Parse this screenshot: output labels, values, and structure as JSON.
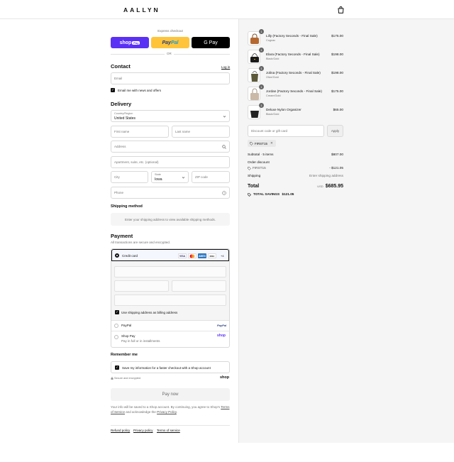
{
  "brand": {
    "name": "AALLYN"
  },
  "express": {
    "title": "Express checkout",
    "shop_label": "shop",
    "shop_badge": "Pay",
    "paypal_label_a": "Pay",
    "paypal_label_b": "Pal",
    "gpay_label": "G Pay",
    "or": "OR"
  },
  "contact": {
    "title": "Contact",
    "login": "Log in",
    "email_placeholder": "Email",
    "news_label": "Email me with news and offers"
  },
  "delivery": {
    "title": "Delivery",
    "country_label": "Country/Region",
    "country_value": "United States",
    "first_name": "First name",
    "last_name": "Last name",
    "address": "Address",
    "apartment": "Apartment, suite, etc. (optional)",
    "city": "City",
    "state_label": "State",
    "state_value": "Iowa",
    "zip": "ZIP code",
    "phone": "Phone"
  },
  "shipping": {
    "title": "Shipping method",
    "info": "Enter your shipping address to view available shipping methods."
  },
  "payment": {
    "title": "Payment",
    "subtitle": "All transactions are secure and encrypted.",
    "credit_card": "Credit card",
    "cards": [
      "VISA",
      "MC",
      "AMEX",
      "DISC"
    ],
    "more_cards": "+4",
    "billing_label": "Use shipping address as billing address",
    "paypal": "PayPal",
    "paypal_logo": "PayPal",
    "shop_pay": "Shop Pay",
    "shop_pay_sub": "Pay in full or in installments",
    "shop_logo": "shop"
  },
  "remember": {
    "title": "Remember me",
    "save_label": "Save my information for a faster checkout with a Shop account",
    "secure": "Secure and encrypted",
    "shop_logo": "shop"
  },
  "paynow": {
    "label": "Pay now"
  },
  "terms": {
    "prefix": "Your info will be saved to a Shop account. By continuing, you agree to Shop's",
    "tos": "Terms of Service",
    "mid": "and acknowledge the",
    "privacy": "Privacy Policy",
    "end": "."
  },
  "footer": {
    "links": [
      "Refund policy",
      "Privacy policy",
      "Terms of service"
    ]
  },
  "cart": {
    "items": [
      {
        "qty": "1",
        "name": "Lilly (Factory Seconds - Final Sale)",
        "variant": "Cognac",
        "price": "$175.00",
        "color": "#b4682f"
      },
      {
        "qty": "1",
        "name": "Elara (Factory Seconds - Final Sale)",
        "variant": "Black/Gold",
        "price": "$198.00",
        "color": "#1a1a1a"
      },
      {
        "qty": "1",
        "name": "Jolina (Factory Seconds - Final Sale)",
        "variant": "Olive/Gold",
        "price": "$198.00",
        "color": "#5c5a3a"
      },
      {
        "qty": "1",
        "name": "Jordan (Factory Seconds - Final Sale)",
        "variant": "Cream/Gold",
        "price": "$175.00",
        "color": "#c9b9a6"
      },
      {
        "qty": "1",
        "name": "Deluxe Nylon Organizer",
        "variant": "Black/Gold",
        "price": "$65.00",
        "color": "#222222"
      }
    ],
    "discount_placeholder": "Discount code or gift card",
    "apply": "Apply",
    "code": "FIRST15",
    "subtotal_label": "Subtotal · 5 items",
    "subtotal": "$807.00",
    "order_discount": "Order discount",
    "discount_code": "FIRST15",
    "discount_amount": "- $121.05",
    "shipping_label": "Shipping",
    "shipping_value": "Enter shipping address",
    "total_label": "Total",
    "currency": "USD",
    "total": "$685.95",
    "savings_label": "TOTAL SAVINGS",
    "savings": "$121.05"
  }
}
